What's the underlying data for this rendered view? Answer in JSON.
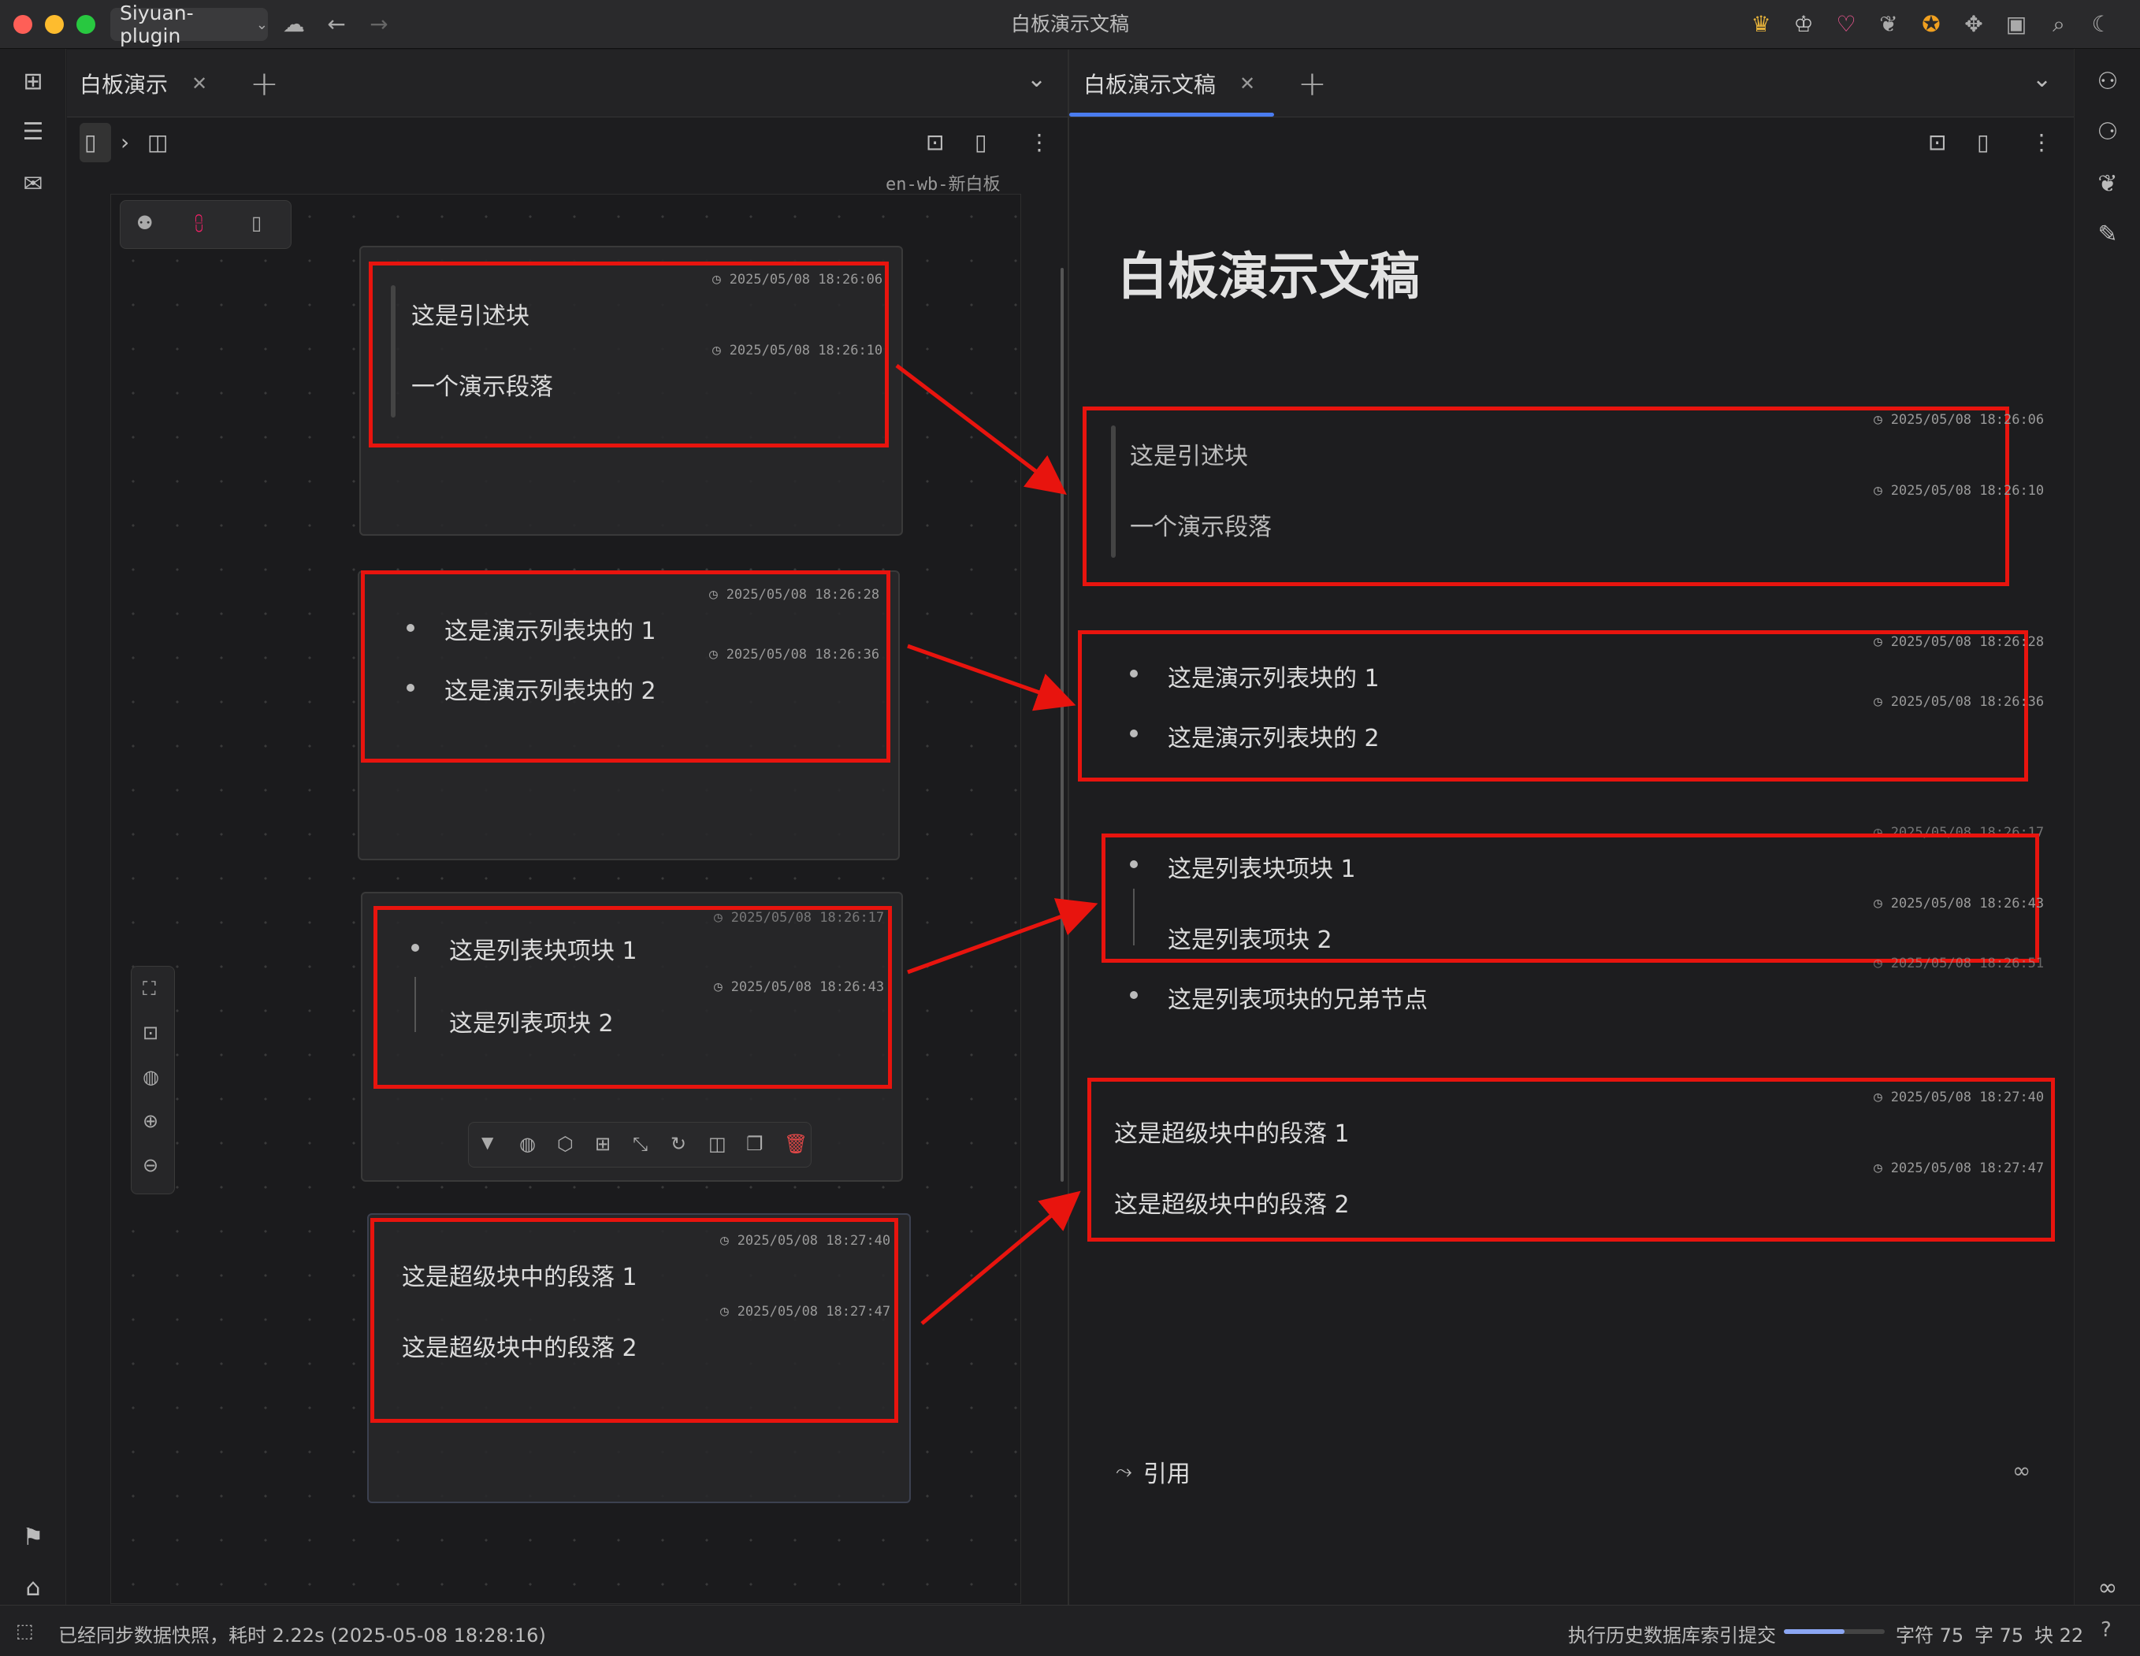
{
  "titlebar": {
    "workspace": "Siyuan-plugin",
    "title": "白板演示文稿"
  },
  "left_pane": {
    "tab_label": "白板演示",
    "whiteboard_name": "en-wb-新白板",
    "cards": [
      {
        "rows": [
          {
            "ts": "2025/05/08 18:26:06",
            "text": "这是引述块"
          },
          {
            "ts": "2025/05/08 18:26:10",
            "text": "一个演示段落"
          }
        ]
      },
      {
        "rows": [
          {
            "ts": "2025/05/08 18:26:28",
            "text": "这是演示列表块的 1"
          },
          {
            "ts": "2025/05/08 18:26:36",
            "text": "这是演示列表块的 2"
          }
        ]
      },
      {
        "rows": [
          {
            "ts": "2025/05/08 18:26:17",
            "text": "这是列表块项块 1"
          },
          {
            "ts": "2025/05/08 18:26:43",
            "text": "这是列表项块 2"
          }
        ]
      },
      {
        "rows": [
          {
            "ts": "2025/05/08 18:27:40",
            "text": "这是超级块中的段落 1"
          },
          {
            "ts": "2025/05/08 18:27:47",
            "text": "这是超级块中的段落 2"
          }
        ]
      }
    ]
  },
  "right_pane": {
    "tab_label": "白板演示文稿",
    "doc_title": "白板演示文稿",
    "blocks": [
      {
        "ts": "2025/05/08 18:26:06",
        "text": "这是引述块"
      },
      {
        "ts": "2025/05/08 18:26:10",
        "text": "一个演示段落"
      },
      {
        "ts": "2025/05/08 18:26:28",
        "text": "这是演示列表块的 1"
      },
      {
        "ts": "2025/05/08 18:26:36",
        "text": "这是演示列表块的 2"
      },
      {
        "ts": "2025/05/08 18:26:17",
        "text": "这是列表块项块 1"
      },
      {
        "ts": "2025/05/08 18:26:43",
        "text": "这是列表项块 2"
      },
      {
        "ts": "2025/05/08 18:26:51",
        "text": "这是列表项块的兄弟节点"
      },
      {
        "ts": "2025/05/08 18:27:40",
        "text": "这是超级块中的段落 1"
      },
      {
        "ts": "2025/05/08 18:27:47",
        "text": "这是超级块中的段落 2"
      }
    ],
    "backlinks_label": "引用"
  },
  "status": {
    "message": "已经同步数据快照，耗时 2.22s (2025-05-08 18:28:16)",
    "task": "执行历史数据库索引提交",
    "chars": "字符 75",
    "words": "字 75",
    "blocks": "块 22",
    "task_progress": 0.6
  },
  "colors": {
    "annotation": "#e8140e",
    "background": "#1d1d1f"
  }
}
